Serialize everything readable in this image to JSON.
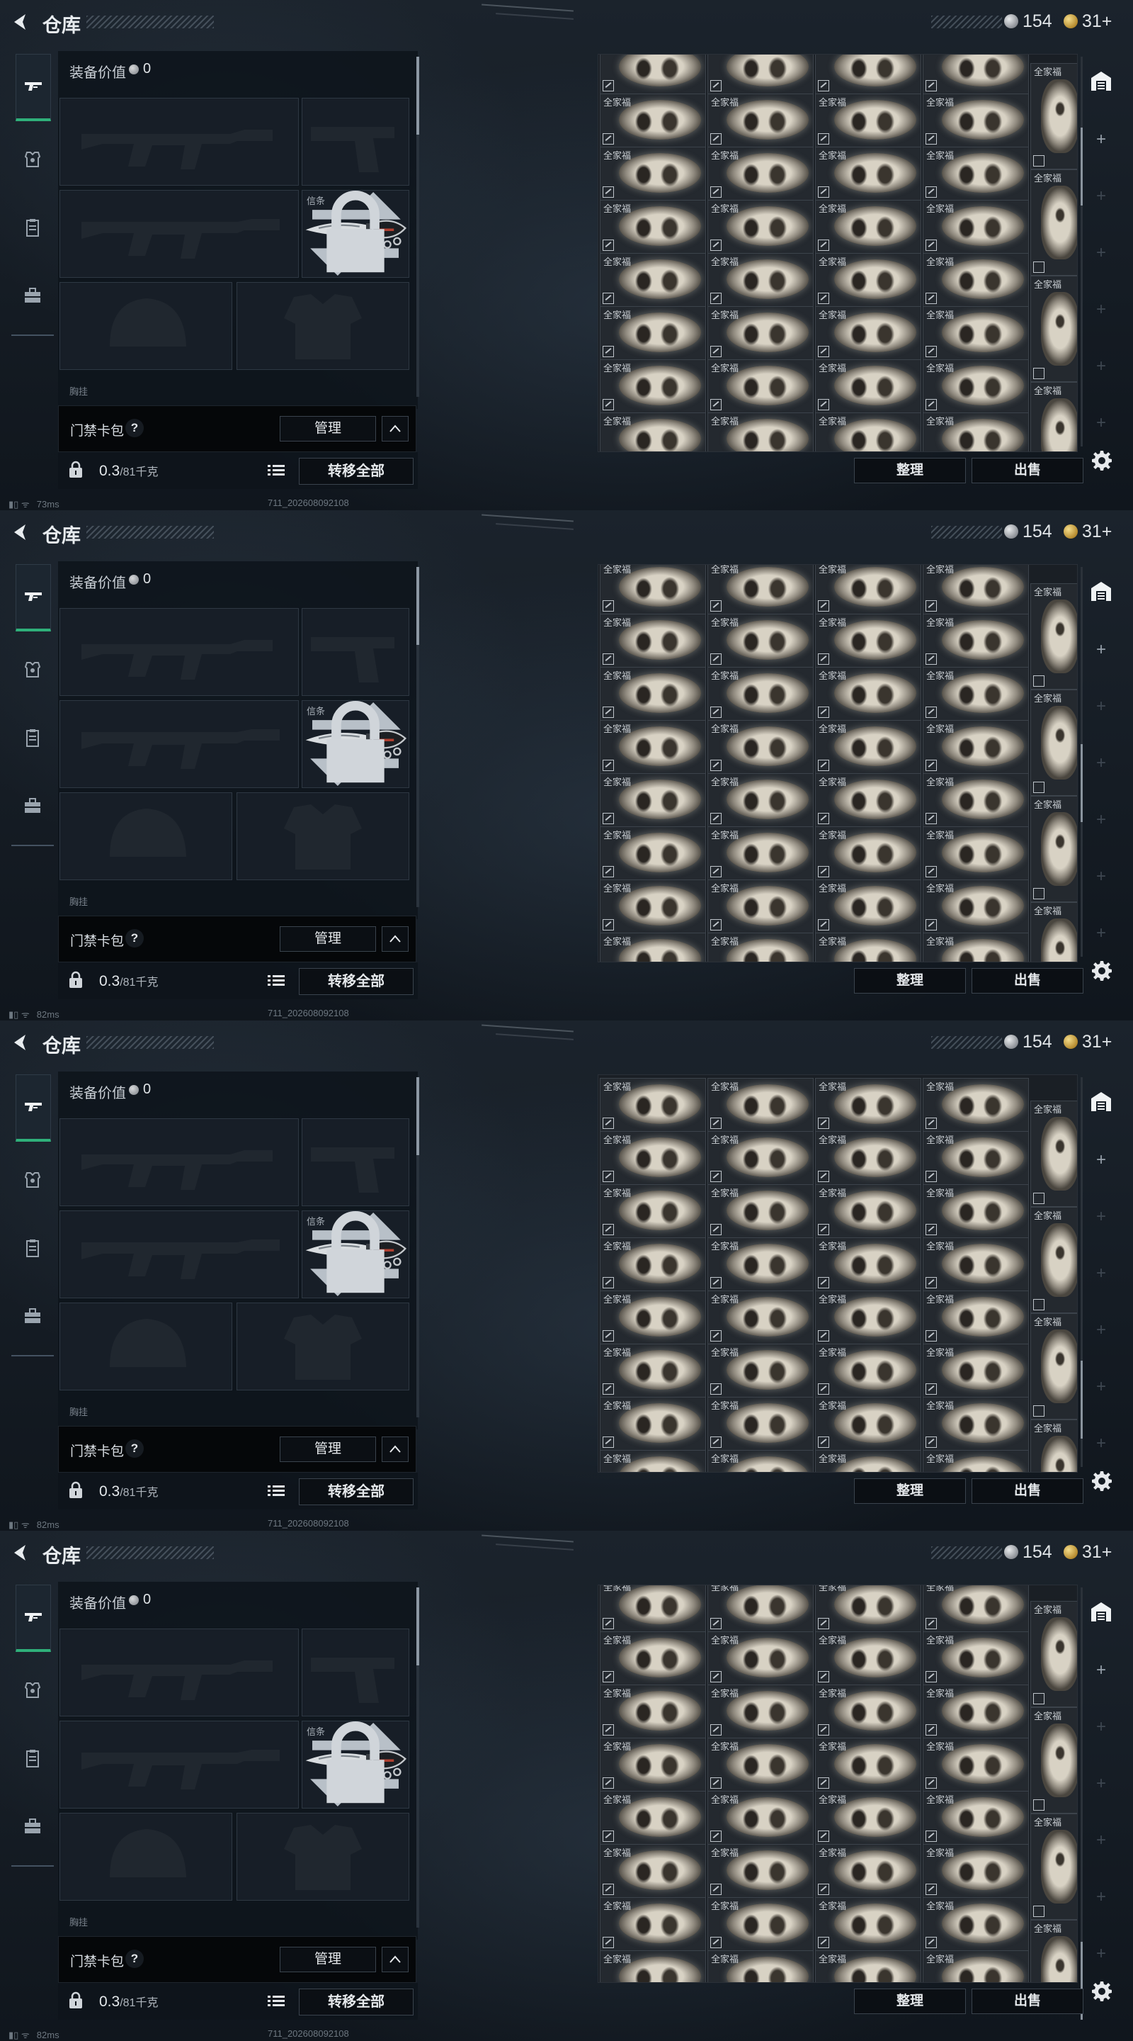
{
  "header": {
    "title": "仓库",
    "currency_silver": "154",
    "currency_gold": "31+"
  },
  "left_nav": {
    "items": [
      "gun-icon",
      "armor-icon",
      "clipboard-icon",
      "briefcase-icon"
    ]
  },
  "equipment": {
    "value_label": "装备价值",
    "value": "0",
    "melee_slot_label": "信条",
    "next_section_label": "胸挂"
  },
  "access_pack": {
    "label": "门禁卡包",
    "help": "?",
    "manage_label": "管理"
  },
  "weight": {
    "current": "0.3",
    "capacity": "/81千克",
    "transfer_all_label": "转移全部"
  },
  "status": {
    "pings": [
      "73ms",
      "82ms",
      "82ms",
      "82ms"
    ],
    "build_id": "711_202608092108"
  },
  "stash": {
    "item_name": "全家福",
    "sort_label": "整理",
    "sell_label": "出售"
  },
  "colors": {
    "accent_green": "#2fb07a",
    "background": "#151c24"
  }
}
